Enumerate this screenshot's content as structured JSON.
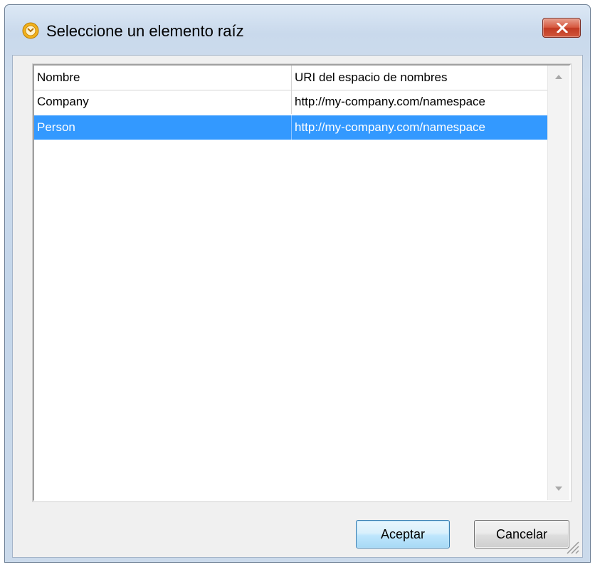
{
  "window": {
    "title": "Seleccione un elemento raíz",
    "icon": "altova-mapforce-icon",
    "close_icon": "close-icon"
  },
  "list": {
    "columns": [
      "Nombre",
      "URI del espacio de nombres"
    ],
    "rows": [
      {
        "name": "Company",
        "uri": "http://my-company.com/namespace",
        "selected": false
      },
      {
        "name": "Person",
        "uri": "http://my-company.com/namespace",
        "selected": true
      }
    ],
    "selection_color": "#3399ff"
  },
  "buttons": {
    "ok_label": "Aceptar",
    "cancel_label": "Cancelar"
  }
}
